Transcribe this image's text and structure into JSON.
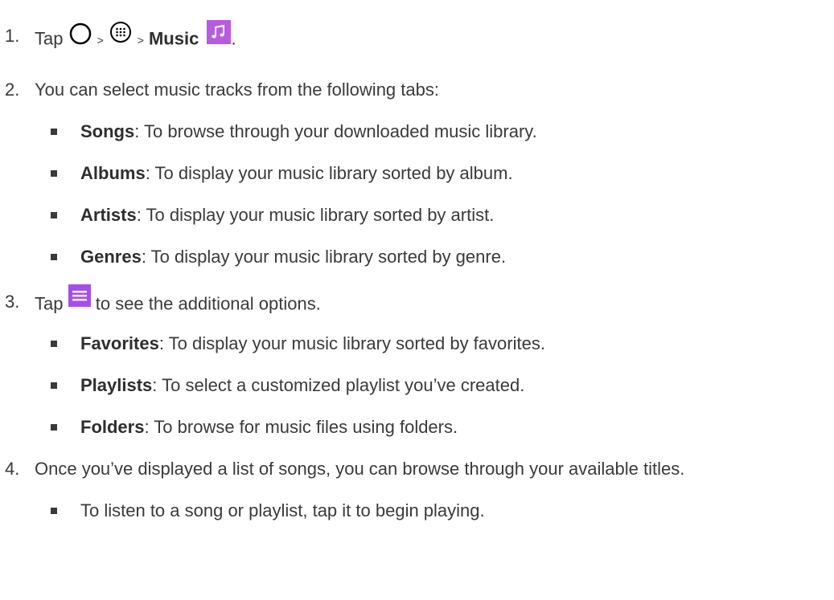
{
  "steps": [
    {
      "number": "1.",
      "tap": "Tap",
      "gt1": ">",
      "gt2": ">",
      "music": "Music",
      "period": "."
    },
    {
      "number": "2.",
      "text": "You can select music tracks from the following tabs:"
    },
    {
      "number": "3.",
      "tap": "Tap",
      "after": "to see the additional options."
    },
    {
      "number": "4.",
      "text": "Once you’ve displayed a list of songs, you can browse through your available titles."
    }
  ],
  "step2_bullets": [
    {
      "label": "Songs",
      "desc": ": To browse through your downloaded music library."
    },
    {
      "label": "Albums",
      "desc": ": To display your music library sorted by album."
    },
    {
      "label": "Artists",
      "desc": ": To display your music library sorted by artist."
    },
    {
      "label": "Genres",
      "desc": ": To display your music library sorted by genre."
    }
  ],
  "step3_bullets": [
    {
      "label": "Favorites",
      "desc": ": To display your music library sorted by favorites."
    },
    {
      "label": "Playlists",
      "desc": ": To select a customized playlist you’ve created."
    },
    {
      "label": "Folders",
      "desc": ": To browse for music files using folders."
    }
  ],
  "step4_bullets": [
    {
      "text": "To listen to a song or playlist, tap it to begin playing."
    }
  ],
  "icons": {
    "home": "home-circle-icon",
    "apps": "apps-grid-icon",
    "music": "music-note-icon",
    "menu": "menu-icon",
    "music_color": "#b75be0",
    "menu_color": "#a64fe6"
  }
}
